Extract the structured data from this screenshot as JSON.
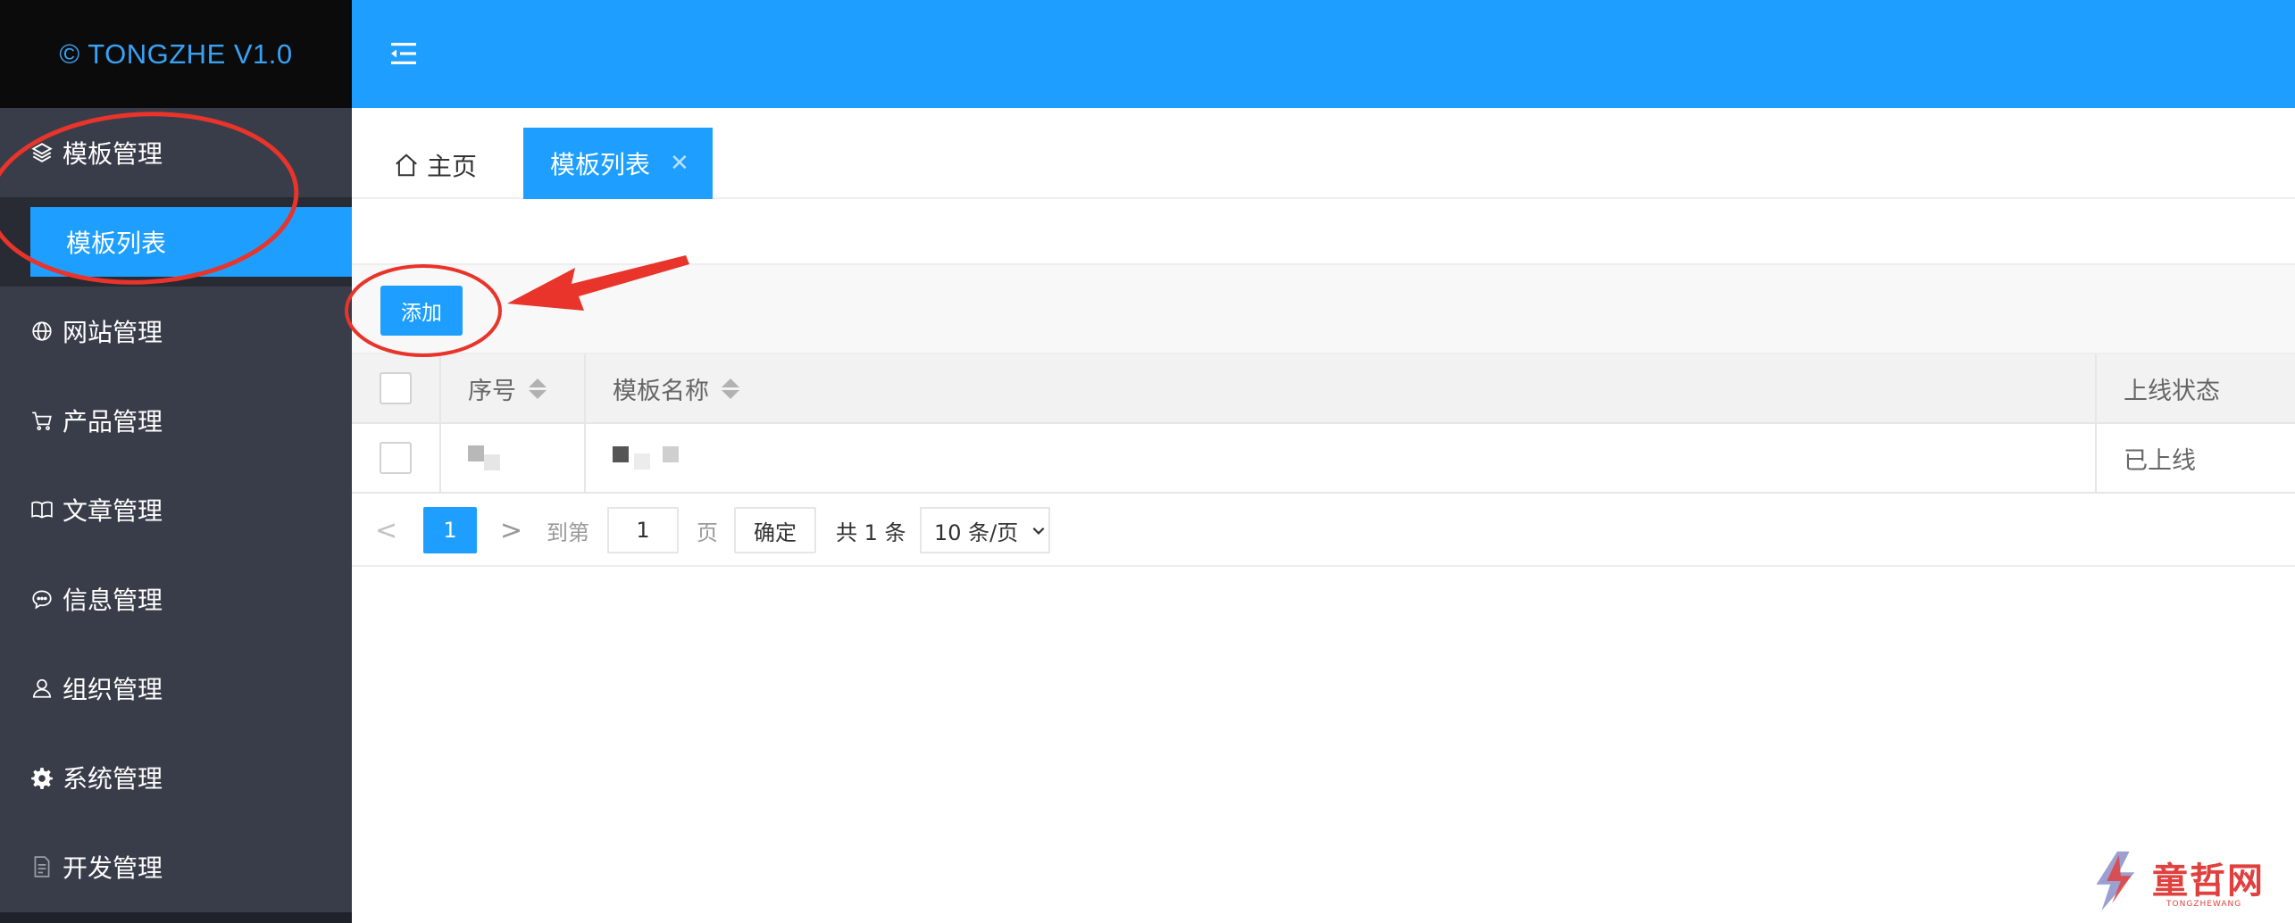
{
  "app": {
    "logo_text": "© TONGZHE V1.0"
  },
  "sidebar": {
    "items": [
      {
        "label": "模板管理",
        "icon": "layers-icon"
      },
      {
        "label": "网站管理",
        "icon": "globe-icon"
      },
      {
        "label": "产品管理",
        "icon": "cart-icon"
      },
      {
        "label": "文章管理",
        "icon": "book-icon"
      },
      {
        "label": "信息管理",
        "icon": "chat-icon"
      },
      {
        "label": "组织管理",
        "icon": "user-icon"
      },
      {
        "label": "系统管理",
        "icon": "gear-icon"
      },
      {
        "label": "开发管理",
        "icon": "document-icon"
      }
    ],
    "sub_items": [
      {
        "label": "模板列表"
      }
    ]
  },
  "header": {
    "menu_icon": "menu-fold-icon"
  },
  "tabs": {
    "home_label": "主页",
    "active_label": "模板列表",
    "close_glyph": "✕"
  },
  "toolbar": {
    "add_label": "添加"
  },
  "table": {
    "columns": [
      "序号",
      "模板名称",
      "上线状态"
    ],
    "rows": [
      {
        "status": "已上线"
      }
    ]
  },
  "pagination": {
    "prev": "<",
    "current_page": "1",
    "next": ">",
    "goto_label": "到第",
    "goto_value": "1",
    "page_label": "页",
    "confirm_label": "确定",
    "total_label": "共 1 条",
    "page_size": "10 条/页"
  },
  "watermark": {
    "text": "童哲网",
    "sub": "TONGZHEWANG"
  },
  "colors": {
    "accent": "#1e9fff",
    "sidebar_bg": "#393d49",
    "logo_bg": "#0b0b0b",
    "annotation_red": "#e8342a"
  }
}
